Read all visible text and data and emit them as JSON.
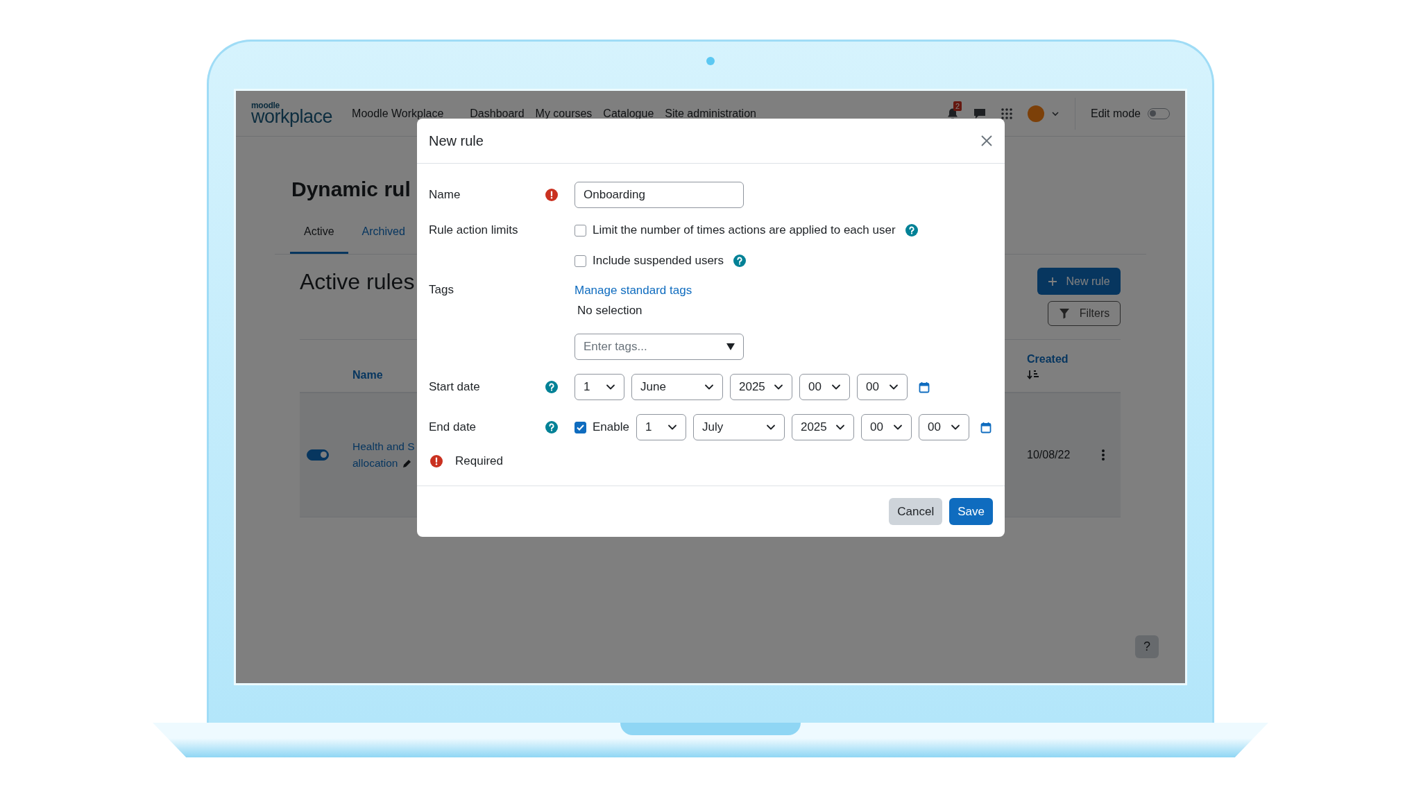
{
  "navbar": {
    "logo_top": "moodle",
    "logo_bottom": "workplace",
    "items": [
      "Moodle Workplace",
      "Dashboard",
      "My courses",
      "Catalogue",
      "Site administration"
    ],
    "notification_count": "2",
    "edit_mode": {
      "label": "Edit mode",
      "on": false
    }
  },
  "page": {
    "title": "Dynamic rul",
    "tabs": [
      {
        "label": "Active",
        "selected": true
      },
      {
        "label": "Archived",
        "selected": false
      }
    ],
    "section_title": "Active rules",
    "new_rule_button": "New rule",
    "filters_button": "Filters",
    "table": {
      "columns": [
        "Name",
        "Created"
      ],
      "rows": [
        {
          "enabled": true,
          "name_lines": [
            "Health and S",
            "allocation"
          ],
          "created": "10/08/22"
        }
      ]
    },
    "help_button": "?"
  },
  "modal": {
    "title": "New rule",
    "fields": [
      {
        "kind": "text",
        "label": "Name",
        "required": true,
        "value": "Onboarding"
      },
      {
        "kind": "checkboxes",
        "label": "Rule action limits",
        "options": [
          {
            "label": "Limit the number of times actions are applied to each user",
            "checked": false,
            "help": true
          },
          {
            "label": "Include suspended users",
            "checked": false,
            "help": true
          }
        ]
      },
      {
        "kind": "tags",
        "label": "Tags",
        "link": "Manage standard tags",
        "selection": "No selection",
        "placeholder": "Enter tags..."
      },
      {
        "kind": "date",
        "label": "Start date",
        "help": true,
        "parts": [
          "1",
          "June",
          "2025",
          "00",
          "00"
        ]
      },
      {
        "kind": "date",
        "label": "End date",
        "help": true,
        "enable": {
          "label": "Enable",
          "checked": true
        },
        "parts": [
          "1",
          "July",
          "2025",
          "00",
          "00"
        ]
      }
    ],
    "required_note": "Required",
    "buttons": [
      {
        "label": "Cancel",
        "kind": "secondary"
      },
      {
        "label": "Save",
        "kind": "primary"
      }
    ]
  }
}
